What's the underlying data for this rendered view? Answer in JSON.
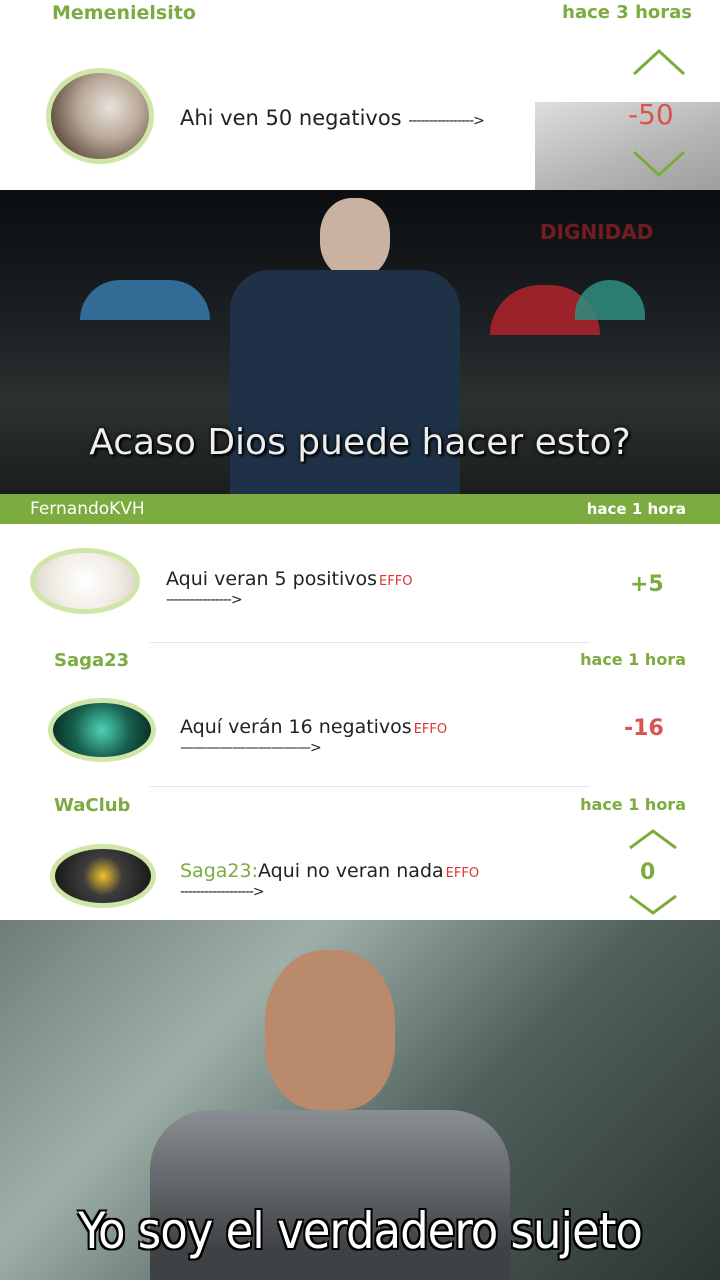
{
  "comments": [
    {
      "user": "Memenielsito",
      "time": "hace 3 horas",
      "text": "Ahi ven 50 negativos",
      "arrow": "---------------->",
      "score": "-50"
    },
    {
      "user": "FernandoKVH",
      "time": "hace 1 hora",
      "text": "Aqui veran 5 positivos",
      "arrow": "---------------->",
      "score": "+5"
    },
    {
      "user": "Saga23",
      "time": "hace 1 hora",
      "text": "Aquí verán 16 negativos",
      "arrow": "——————————>",
      "score": "-16"
    },
    {
      "user": "WaClub",
      "time": "hace 1 hora",
      "mention": "Saga23:",
      "text": "Aqui no veran nada",
      "arrow": "------------------>",
      "score": "0"
    }
  ],
  "memes": {
    "top_caption": "Acaso Dios puede hacer esto?",
    "top_watermark": "DIGNIDAD",
    "bottom_caption": "Yo soy el verdadero sujeto"
  },
  "troll_label": "EFFO",
  "colors": {
    "accent": "#7cab40",
    "negative": "#d9534f",
    "header_bar": "#7cab40"
  }
}
